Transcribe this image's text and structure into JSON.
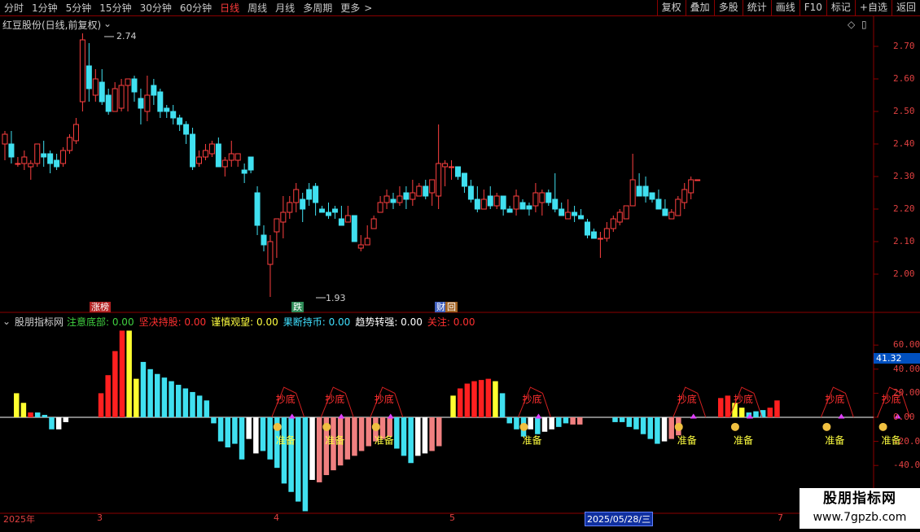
{
  "toolbar": {
    "periods": [
      "分时",
      "1分钟",
      "5分钟",
      "15分钟",
      "30分钟",
      "60分钟",
      "日线",
      "周线",
      "月线",
      "多周期",
      "更多"
    ],
    "active": "日线",
    "more_arrow": ">",
    "right_buttons": [
      "复权",
      "叠加",
      "多股",
      "统计",
      "画线",
      "F10",
      "标记",
      "+自选",
      "返回"
    ]
  },
  "main_chart": {
    "title": "红豆股份(日线,前复权)",
    "high_label": "2.74",
    "low_label": "1.93",
    "price_axis": [
      "2.70",
      "2.60",
      "2.50",
      "2.40",
      "2.30",
      "2.20",
      "2.10",
      "2.00"
    ],
    "markers": [
      {
        "text": "涨榜",
        "color": "#ffffff",
        "bg": "#b22222"
      },
      {
        "text": "跌",
        "color": "#ffffff",
        "bg": "#2e8b57"
      },
      {
        "text": "财",
        "color": "#ffffff",
        "bg": "#4060c0"
      },
      {
        "text": "回",
        "color": "#ffffff",
        "bg": "#a06020"
      }
    ],
    "candles": [
      [
        2.4,
        2.43,
        2.44,
        2.35
      ],
      [
        2.4,
        2.36,
        2.44,
        2.34
      ],
      [
        2.34,
        2.34,
        2.36,
        2.33
      ],
      [
        2.34,
        2.36,
        2.38,
        2.32
      ],
      [
        2.33,
        2.34,
        2.35,
        2.29
      ],
      [
        2.34,
        2.4,
        2.4,
        2.33
      ],
      [
        2.37,
        2.36,
        2.41,
        2.33
      ],
      [
        2.37,
        2.34,
        2.38,
        2.31
      ],
      [
        2.35,
        2.33,
        2.37,
        2.32
      ],
      [
        2.34,
        2.38,
        2.39,
        2.33
      ],
      [
        2.38,
        2.42,
        2.43,
        2.37
      ],
      [
        2.41,
        2.46,
        2.48,
        2.4
      ],
      [
        2.53,
        2.72,
        2.74,
        2.5
      ],
      [
        2.64,
        2.57,
        2.71,
        2.53
      ],
      [
        2.55,
        2.6,
        2.63,
        2.53
      ],
      [
        2.59,
        2.53,
        2.63,
        2.52
      ],
      [
        2.55,
        2.5,
        2.57,
        2.49
      ],
      [
        2.5,
        2.57,
        2.59,
        2.5
      ],
      [
        2.51,
        2.58,
        2.6,
        2.5
      ],
      [
        2.58,
        2.6,
        2.6,
        2.5
      ],
      [
        2.6,
        2.56,
        2.61,
        2.53
      ],
      [
        2.54,
        2.51,
        2.57,
        2.46
      ],
      [
        2.5,
        2.55,
        2.61,
        2.47
      ],
      [
        2.58,
        2.55,
        2.6,
        2.52
      ],
      [
        2.56,
        2.5,
        2.57,
        2.48
      ],
      [
        2.51,
        2.5,
        2.52,
        2.48
      ],
      [
        2.5,
        2.48,
        2.52,
        2.46
      ],
      [
        2.48,
        2.46,
        2.49,
        2.44
      ],
      [
        2.46,
        2.43,
        2.47,
        2.4
      ],
      [
        2.43,
        2.33,
        2.45,
        2.32
      ],
      [
        2.34,
        2.36,
        2.38,
        2.33
      ],
      [
        2.36,
        2.38,
        2.4,
        2.35
      ],
      [
        2.37,
        2.4,
        2.41,
        2.36
      ],
      [
        2.4,
        2.33,
        2.42,
        2.33
      ],
      [
        2.33,
        2.35,
        2.36,
        2.3
      ],
      [
        2.35,
        2.37,
        2.41,
        2.33
      ],
      [
        2.35,
        2.37,
        2.37,
        2.33
      ],
      [
        2.32,
        2.31,
        2.34,
        2.28
      ],
      [
        2.36,
        2.32,
        2.36,
        2.31
      ],
      [
        2.25,
        2.15,
        2.27,
        2.12
      ],
      [
        2.12,
        2.09,
        2.15,
        2.07
      ],
      [
        2.03,
        2.1,
        2.12,
        1.93
      ],
      [
        2.13,
        2.17,
        2.17,
        2.05
      ],
      [
        2.16,
        2.19,
        2.24,
        2.11
      ],
      [
        2.19,
        2.22,
        2.24,
        2.17
      ],
      [
        2.22,
        2.26,
        2.28,
        2.19
      ],
      [
        2.23,
        2.2,
        2.25,
        2.16
      ],
      [
        2.26,
        2.23,
        2.28,
        2.21
      ],
      [
        2.27,
        2.22,
        2.28,
        2.18
      ],
      [
        2.2,
        2.19,
        2.21,
        2.19
      ],
      [
        2.19,
        2.18,
        2.22,
        2.17
      ],
      [
        2.2,
        2.19,
        2.21,
        2.17
      ],
      [
        2.17,
        2.15,
        2.21,
        2.15
      ],
      [
        2.16,
        2.18,
        2.21,
        2.16
      ],
      [
        2.18,
        2.1,
        2.18,
        2.1
      ],
      [
        2.08,
        2.09,
        2.12,
        2.07
      ],
      [
        2.09,
        2.11,
        2.15,
        2.09
      ],
      [
        2.14,
        2.17,
        2.18,
        2.14
      ],
      [
        2.19,
        2.22,
        2.24,
        2.19
      ],
      [
        2.22,
        2.24,
        2.26,
        2.2
      ],
      [
        2.23,
        2.22,
        2.25,
        2.2
      ],
      [
        2.22,
        2.24,
        2.27,
        2.21
      ],
      [
        2.25,
        2.23,
        2.27,
        2.2
      ],
      [
        2.23,
        2.25,
        2.29,
        2.21
      ],
      [
        2.24,
        2.27,
        2.28,
        2.24
      ],
      [
        2.27,
        2.24,
        2.29,
        2.23
      ],
      [
        2.25,
        2.29,
        2.29,
        2.21
      ],
      [
        2.24,
        2.34,
        2.46,
        2.2
      ],
      [
        2.33,
        2.34,
        2.35,
        2.27
      ],
      [
        2.33,
        2.33,
        2.35,
        2.29
      ],
      [
        2.33,
        2.3,
        2.33,
        2.29
      ],
      [
        2.31,
        2.27,
        2.31,
        2.25
      ],
      [
        2.27,
        2.23,
        2.29,
        2.22
      ],
      [
        2.23,
        2.2,
        2.27,
        2.19
      ],
      [
        2.2,
        2.23,
        2.26,
        2.2
      ],
      [
        2.24,
        2.21,
        2.27,
        2.2
      ],
      [
        2.21,
        2.24,
        2.25,
        2.2
      ],
      [
        2.24,
        2.2,
        2.24,
        2.18
      ],
      [
        2.2,
        2.19,
        2.21,
        2.19
      ],
      [
        2.2,
        2.24,
        2.26,
        2.18
      ],
      [
        2.22,
        2.2,
        2.23,
        2.2
      ],
      [
        2.21,
        2.2,
        2.22,
        2.18
      ],
      [
        2.21,
        2.25,
        2.28,
        2.19
      ],
      [
        2.22,
        2.25,
        2.26,
        2.18
      ],
      [
        2.25,
        2.22,
        2.26,
        2.21
      ],
      [
        2.23,
        2.2,
        2.31,
        2.19
      ],
      [
        2.2,
        2.18,
        2.22,
        2.18
      ],
      [
        2.17,
        2.19,
        2.23,
        2.17
      ],
      [
        2.19,
        2.18,
        2.21,
        2.16
      ],
      [
        2.18,
        2.17,
        2.2,
        2.17
      ],
      [
        2.16,
        2.12,
        2.17,
        2.11
      ],
      [
        2.13,
        2.11,
        2.14,
        2.11
      ],
      [
        2.11,
        2.11,
        2.13,
        2.05
      ],
      [
        2.11,
        2.14,
        2.16,
        2.1
      ],
      [
        2.14,
        2.17,
        2.18,
        2.13
      ],
      [
        2.16,
        2.19,
        2.2,
        2.15
      ],
      [
        2.17,
        2.21,
        2.21,
        2.17
      ],
      [
        2.21,
        2.29,
        2.37,
        2.21
      ],
      [
        2.27,
        2.24,
        2.31,
        2.24
      ],
      [
        2.27,
        2.24,
        2.3,
        2.22
      ],
      [
        2.25,
        2.23,
        2.24,
        2.22
      ],
      [
        2.23,
        2.2,
        2.26,
        2.2
      ],
      [
        2.2,
        2.18,
        2.23,
        2.18
      ],
      [
        2.17,
        2.19,
        2.2,
        2.17
      ],
      [
        2.18,
        2.23,
        2.24,
        2.18
      ],
      [
        2.22,
        2.26,
        2.28,
        2.2
      ],
      [
        2.25,
        2.29,
        2.3,
        2.23
      ],
      [
        2.29,
        2.29,
        2.29,
        2.29
      ]
    ]
  },
  "indicator": {
    "name": "股朋指标网",
    "series_labels": [
      {
        "text": "注意底部: 0.00",
        "color": "#40d040"
      },
      {
        "text": "坚决持股: 0.00",
        "color": "#ff3030"
      },
      {
        "text": "谨慎观望: 0.00",
        "color": "#ffff40"
      },
      {
        "text": "果断持币: 0.00",
        "color": "#40e0ff"
      },
      {
        "text": "趋势转强: 0.00",
        "color": "#ffffff"
      },
      {
        "text": "关注: 0.00",
        "color": "#ff3030"
      }
    ],
    "axis": [
      "60.00",
      "40.00",
      "20.00",
      "0.00",
      "-20.00",
      "-40.00"
    ],
    "current_value": "41.32",
    "bars": [
      [
        20,
        "#ffff30"
      ],
      [
        12,
        "#ffff30"
      ],
      [
        4,
        "#ff2020"
      ],
      [
        4,
        "#40e0f0"
      ],
      [
        2,
        "#40e0f0"
      ],
      [
        -10,
        "#40e0f0"
      ],
      [
        -10,
        "#ffffff"
      ],
      [
        -4,
        "#ffffff"
      ],
      [
        0,
        ""
      ],
      [
        0,
        ""
      ],
      [
        0,
        ""
      ],
      [
        0,
        ""
      ],
      [
        20,
        "#ff2020"
      ],
      [
        35,
        "#ff2020"
      ],
      [
        55,
        "#ff2020"
      ],
      [
        72,
        "#ff2020"
      ],
      [
        72,
        "#ffff30"
      ],
      [
        32,
        "#ffff30"
      ],
      [
        46,
        "#40e0f0"
      ],
      [
        40,
        "#40e0f0"
      ],
      [
        36,
        "#40e0f0"
      ],
      [
        33,
        "#40e0f0"
      ],
      [
        30,
        "#40e0f0"
      ],
      [
        27,
        "#40e0f0"
      ],
      [
        24,
        "#40e0f0"
      ],
      [
        21,
        "#40e0f0"
      ],
      [
        18,
        "#40e0f0"
      ],
      [
        14,
        "#40e0f0"
      ],
      [
        -5,
        "#40e0f0"
      ],
      [
        -20,
        "#40e0f0"
      ],
      [
        -25,
        "#40e0f0"
      ],
      [
        -22,
        "#40e0f0"
      ],
      [
        -35,
        "#40e0f0"
      ],
      [
        -18,
        "#ffffff"
      ],
      [
        -30,
        "#ffffff"
      ],
      [
        -28,
        "#40e0f0"
      ],
      [
        -35,
        "#40e0f0"
      ],
      [
        -42,
        "#40e0f0"
      ],
      [
        -55,
        "#40e0f0"
      ],
      [
        -62,
        "#40e0f0"
      ],
      [
        -70,
        "#40e0f0"
      ],
      [
        -78,
        "#40e0f0"
      ],
      [
        -52,
        "#ffffff"
      ],
      [
        -54,
        "#f08080"
      ],
      [
        -48,
        "#f08080"
      ],
      [
        -44,
        "#f08080"
      ],
      [
        -40,
        "#f08080"
      ],
      [
        -35,
        "#f08080"
      ],
      [
        -32,
        "#f08080"
      ],
      [
        -28,
        "#f08080"
      ],
      [
        -24,
        "#f08080"
      ],
      [
        -20,
        "#f08080"
      ],
      [
        -18,
        "#f08080"
      ],
      [
        -16,
        "#f08080"
      ],
      [
        -26,
        "#40e0f0"
      ],
      [
        -32,
        "#40e0f0"
      ],
      [
        -38,
        "#40e0f0"
      ],
      [
        -32,
        "#ffffff"
      ],
      [
        -30,
        "#ffffff"
      ],
      [
        -28,
        "#f08080"
      ],
      [
        -24,
        "#f08080"
      ],
      [
        0,
        ""
      ],
      [
        18,
        "#ffff30"
      ],
      [
        24,
        "#ff2020"
      ],
      [
        28,
        "#ff2020"
      ],
      [
        30,
        "#ff2020"
      ],
      [
        31,
        "#ff2020"
      ],
      [
        32,
        "#ff2020"
      ],
      [
        30,
        "#ffff30"
      ],
      [
        20,
        "#40e0f0"
      ],
      [
        -5,
        "#40e0f0"
      ],
      [
        -10,
        "#40e0f0"
      ],
      [
        -16,
        "#40e0f0"
      ],
      [
        -10,
        "#ffffff"
      ],
      [
        -14,
        "#40e0f0"
      ],
      [
        -12,
        "#ffffff"
      ],
      [
        -10,
        "#ffffff"
      ],
      [
        -8,
        "#40e0f0"
      ],
      [
        -5,
        "#40e0f0"
      ],
      [
        -6,
        "#f08080"
      ],
      [
        -6,
        "#f08080"
      ],
      [
        0,
        ""
      ],
      [
        0,
        ""
      ],
      [
        0,
        ""
      ],
      [
        0,
        ""
      ],
      [
        -4,
        "#40e0f0"
      ],
      [
        -4,
        "#40e0f0"
      ],
      [
        -8,
        "#40e0f0"
      ],
      [
        -10,
        "#40e0f0"
      ],
      [
        -14,
        "#40e0f0"
      ],
      [
        -18,
        "#40e0f0"
      ],
      [
        -22,
        "#40e0f0"
      ],
      [
        -20,
        "#ffffff"
      ],
      [
        -18,
        "#f08080"
      ],
      [
        -15,
        "#f08080"
      ],
      [
        0,
        ""
      ],
      [
        0,
        ""
      ],
      [
        0,
        ""
      ],
      [
        0,
        ""
      ],
      [
        0,
        ""
      ],
      [
        16,
        "#ff2020"
      ],
      [
        18,
        "#ff2020"
      ],
      [
        12,
        "#ffff30"
      ],
      [
        8,
        "#ffff30"
      ],
      [
        4,
        "#40e0f0"
      ],
      [
        5,
        "#40e0f0"
      ],
      [
        6,
        "#40e0f0"
      ],
      [
        8,
        "#ff2020"
      ],
      [
        14,
        "#ff2020"
      ]
    ],
    "signals": [
      {
        "bar": 38,
        "top": "抄底",
        "bottom": "准备"
      },
      {
        "bar": 45,
        "top": "抄底",
        "bottom": "准备"
      },
      {
        "bar": 52,
        "top": "抄底",
        "bottom": "准备"
      },
      {
        "bar": 73,
        "top": "抄底",
        "bottom": "准备"
      },
      {
        "bar": 95,
        "top": "抄底",
        "bottom": "准备"
      },
      {
        "bar": 103,
        "top": "抄底",
        "bottom": "准备"
      },
      {
        "bar": 116,
        "top": "抄底",
        "bottom": "准备"
      },
      {
        "bar": 124,
        "top": "抄底",
        "bottom": "准备"
      }
    ]
  },
  "date_axis": {
    "labels": [
      "2025年",
      "3",
      "4",
      "5",
      "7"
    ],
    "current": "2025/05/28/三"
  },
  "watermark": {
    "line1": "股朋指标网",
    "line2": "www.7gpzb.com"
  },
  "colors": {
    "up": "#ff4040",
    "down": "#40e0f0",
    "grid": "#8b0000",
    "axis_text": "#e04040"
  }
}
